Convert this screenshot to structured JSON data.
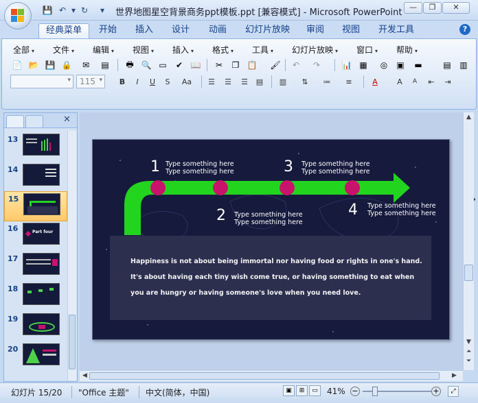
{
  "window": {
    "title": "世界地图星空背景商务ppt模板.ppt [兼容模式] - Microsoft PowerPoint",
    "controls": [
      "—",
      "❐",
      "✕"
    ]
  },
  "quick_access": [
    "save-icon",
    "undo-icon",
    "redo-icon",
    "customize-icon"
  ],
  "ribbon_tabs": [
    "经典菜单",
    "开始",
    "插入",
    "设计",
    "动画",
    "幻灯片放映",
    "审阅",
    "视图",
    "开发工具"
  ],
  "active_tab": "经典菜单",
  "classic_menu": [
    "全部",
    "文件",
    "编辑",
    "视图",
    "插入",
    "格式",
    "工具",
    "幻灯片放映",
    "窗口",
    "帮助"
  ],
  "font_size_value": "115",
  "slides_pane": {
    "items": [
      {
        "num": "13"
      },
      {
        "num": "14"
      },
      {
        "num": "15"
      },
      {
        "num": "16",
        "caption": "Part four"
      },
      {
        "num": "17"
      },
      {
        "num": "18"
      },
      {
        "num": "19"
      },
      {
        "num": "20"
      }
    ],
    "selected": "15"
  },
  "slide": {
    "steps": [
      {
        "number": "1",
        "line1": "Type something here",
        "line2": "Type something here"
      },
      {
        "number": "2",
        "line1": "Type something here",
        "line2": "Type something here"
      },
      {
        "number": "3",
        "line1": "Type something here",
        "line2": "Type something here"
      },
      {
        "number": "4",
        "line1": "Type something here",
        "line2": "Type something here"
      }
    ],
    "quote_lines": [
      "Happiness is not about being immortal nor having food or rights in one's hand.",
      "It's about having each tiny wish come true, or having something to eat when",
      "you are hungry or having someone's love when you need love."
    ],
    "colors": {
      "background": "#161a3c",
      "arrow": "#22d41e",
      "dot": "#c8136c",
      "box": "#2e314f"
    }
  },
  "status": {
    "slide_info": "幻灯片 15/20",
    "theme": "\"Office 主题\"",
    "language": "中文(简体，中国)",
    "zoom": "41%"
  }
}
